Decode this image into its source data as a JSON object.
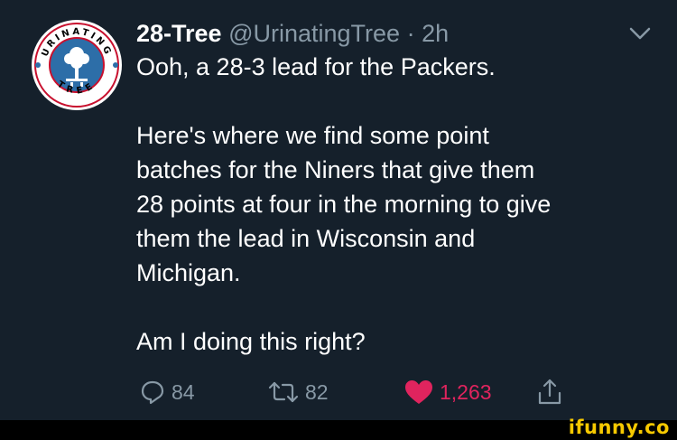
{
  "tweet": {
    "display_name": "28-Tree",
    "handle": "@UrinatingTree",
    "separator": "·",
    "time": "2h",
    "body_lines": [
      "Ooh, a 28-3 lead for the Packers.",
      "",
      "Here's where we find some point",
      "batches for the Niners that give them",
      "28 points at four in the morning to give",
      "them the lead in Wisconsin and",
      "Michigan.",
      "",
      "Am I doing this right?"
    ],
    "avatar": {
      "top_text": "URINATING",
      "bottom_text": "TREE"
    }
  },
  "actions": {
    "replies": "84",
    "retweets": "82",
    "likes": "1,263"
  },
  "icons": {
    "reply": "reply-icon",
    "retweet": "retweet-icon",
    "like": "heart-icon",
    "share": "share-icon",
    "caret": "chevron-down-icon"
  },
  "colors": {
    "background": "#15202b",
    "secondary_text": "#8899a6",
    "like": "#e0245e",
    "watermark": "#f7c900"
  },
  "watermark": "ifunny.co"
}
